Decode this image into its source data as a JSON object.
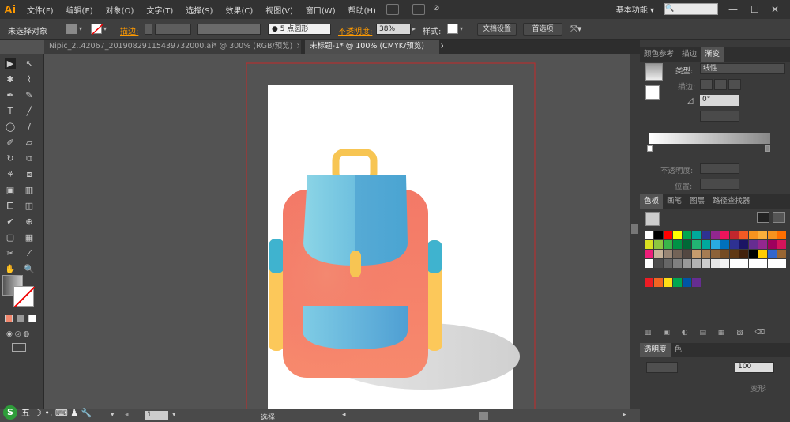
{
  "app": {
    "logo": "Ai",
    "workspace": "基本功能",
    "workspace_arrow": "▾",
    "search_icon": "🔍"
  },
  "menu": [
    "文件(F)",
    "编辑(E)",
    "对象(O)",
    "文字(T)",
    "选择(S)",
    "效果(C)",
    "视图(V)",
    "窗口(W)",
    "帮助(H)"
  ],
  "window_controls": {
    "min": "—",
    "max": "☐",
    "close": "✕"
  },
  "control_bar": {
    "selection_status": "未选择对象",
    "stroke_label": "描边:",
    "brush_label": "5 点圆形",
    "opacity_label": "不透明度:",
    "opacity_value": "38%",
    "style_label": "样式:",
    "doc_setup_button": "文档设置",
    "preferences_button": "首选项"
  },
  "tabs": [
    {
      "label": "Nipic_2..42067_20190829115439732000.ai* @ 300% (RGB/预览)",
      "close": "×"
    },
    {
      "label": "未标题-1* @ 100% (CMYK/预览)",
      "close": "×"
    }
  ],
  "tools": [
    "▶",
    "↖",
    "✱",
    "⌇",
    "✒",
    "✎",
    "T",
    "╱",
    "◯",
    "∕",
    "✐",
    "▱",
    "↻",
    "⧉",
    "⚘",
    "⧈",
    "▣",
    "▥",
    "⧠",
    "◫",
    "✔",
    "⊕",
    "▢",
    "▦",
    "✂",
    "⁄",
    "✋",
    "🔍"
  ],
  "gradient_panel": {
    "tabs": [
      "颜色参考",
      "描边",
      "渐变"
    ],
    "type_label": "类型:",
    "type_value": "线性",
    "stroke_label": "描边:",
    "angle_symbol": "◿",
    "angle_value": "0°",
    "opacity_label": "不透明度:",
    "location_label": "位置:"
  },
  "swatches_panel": {
    "tabs": [
      "色板",
      "画笔",
      "图层",
      "路径查找器"
    ],
    "colors": [
      "#ffffff",
      "#000000",
      "#ff0000",
      "#ffff00",
      "#00a651",
      "#00a99d",
      "#2e3192",
      "#92278f",
      "#ed145b",
      "#c1272d",
      "#f15a24",
      "#f7931e",
      "#fbb03b",
      "#f7931e",
      "#ff6f00",
      "#d9e021",
      "#8cc63f",
      "#39b54a",
      "#009245",
      "#006837",
      "#22b573",
      "#00a99d",
      "#29abe2",
      "#0071bc",
      "#2e3192",
      "#1b1464",
      "#662d91",
      "#93278f",
      "#9e005d",
      "#d4145a",
      "#ed1e79",
      "#c7b299",
      "#998675",
      "#736357",
      "#534741",
      "#c69c6d",
      "#a67c52",
      "#8c6239",
      "#754c24",
      "#603813",
      "#42210b",
      "#000000",
      "#ffcc00",
      "#3366cc",
      "#996633",
      "#ffffff",
      "#4d4d4d",
      "#666666",
      "#808080",
      "#999999",
      "#b3b3b3",
      "#cccccc",
      "#e6e6e6",
      "#f2f2f2",
      "#ffffff",
      "#ffffff",
      "#ffffff",
      "#ffffff",
      "#ffffff",
      "#ffffff"
    ],
    "extra_row": [
      "#ed1c24",
      "#f26522",
      "#ffde17",
      "#00a651",
      "#0054a6",
      "#662d91"
    ]
  },
  "transparency_panel": {
    "title": "透明度",
    "color_tab": "色",
    "value": "100",
    "mode": "变形"
  },
  "status": {
    "zoom_value": "1",
    "label": "选择"
  },
  "ime": {
    "brand": "S",
    "mode": "五",
    "icons": "☽ •, ⌨ ♟ 🔧"
  },
  "artwork": {
    "artboard": "white",
    "bag_body_top": "#f2876d",
    "bag_body_bottom": "#f8856d",
    "bag_body_highlight": "#f0a28a",
    "flap_left": "#7fd0e4",
    "flap_right": "#4da5d1",
    "handle": "#f7c553",
    "side": "#3fb3cf",
    "side_lower": "#fcc85a",
    "shadow": "#d9d9d9"
  }
}
